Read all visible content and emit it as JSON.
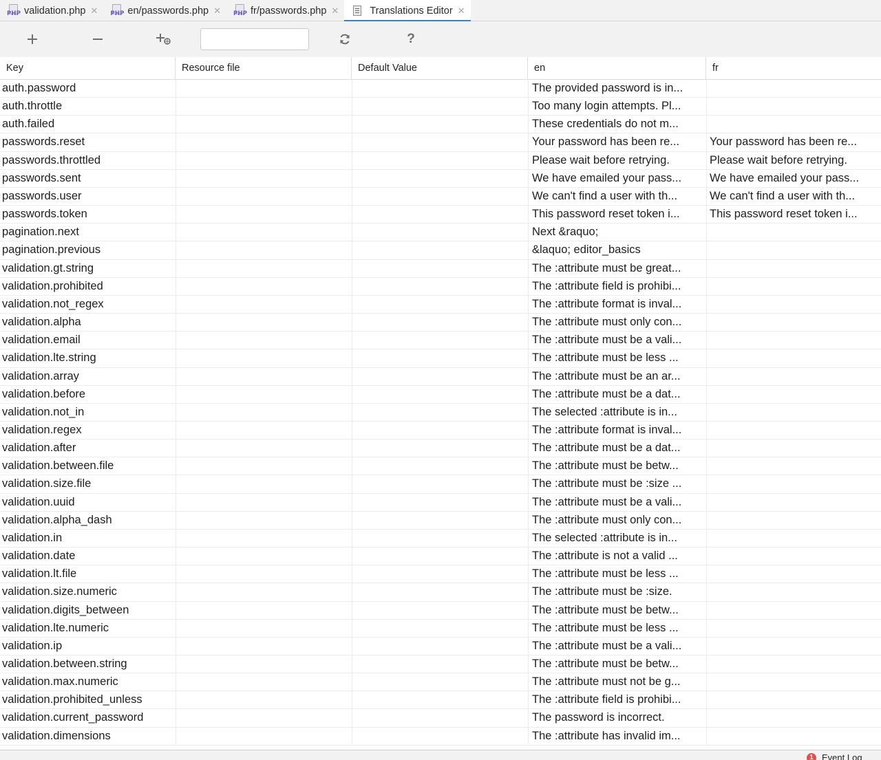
{
  "tabs": [
    {
      "label": "validation.php",
      "icon": "php-file-icon",
      "badge": "PHP"
    },
    {
      "label": "en/passwords.php",
      "icon": "php-file-icon",
      "badge": "PHP"
    },
    {
      "label": "fr/passwords.php",
      "icon": "php-file-icon",
      "badge": "PHP"
    },
    {
      "label": "Translations Editor",
      "icon": "document-icon",
      "active": true
    }
  ],
  "toolbar": {
    "add_icon": "plus-icon",
    "remove_icon": "minus-icon",
    "add_locale_icon": "add-locale-icon",
    "search_value": "",
    "refresh_icon": "refresh-icon",
    "help_label": "?"
  },
  "table": {
    "columns": [
      "Key",
      "Resource file",
      "Default Value",
      "en",
      "fr"
    ],
    "rows": [
      {
        "key": "auth.password",
        "resource": "",
        "default": "",
        "en": "The provided password is in...",
        "fr": ""
      },
      {
        "key": "auth.throttle",
        "resource": "",
        "default": "",
        "en": "Too many login attempts. Pl...",
        "fr": ""
      },
      {
        "key": "auth.failed",
        "resource": "",
        "default": "",
        "en": "These credentials do not m...",
        "fr": ""
      },
      {
        "key": "passwords.reset",
        "resource": "",
        "default": "",
        "en": "Your password has been re...",
        "fr": "Your password has been re..."
      },
      {
        "key": "passwords.throttled",
        "resource": "",
        "default": "",
        "en": "Please wait before retrying.",
        "fr": "Please wait before retrying."
      },
      {
        "key": "passwords.sent",
        "resource": "",
        "default": "",
        "en": "We have emailed your pass...",
        "fr": "We have emailed your pass..."
      },
      {
        "key": "passwords.user",
        "resource": "",
        "default": "",
        "en": "We can't find a user with th...",
        "fr": "We can't find a user with th..."
      },
      {
        "key": "passwords.token",
        "resource": "",
        "default": "",
        "en": "This password reset token i...",
        "fr": "This password reset token i..."
      },
      {
        "key": "pagination.next",
        "resource": "",
        "default": "",
        "en": "Next &raquo;",
        "fr": ""
      },
      {
        "key": "pagination.previous",
        "resource": "",
        "default": "",
        "en": "&laquo; editor_basics",
        "fr": ""
      },
      {
        "key": "validation.gt.string",
        "resource": "",
        "default": "",
        "en": "The :attribute must be great...",
        "fr": ""
      },
      {
        "key": "validation.prohibited",
        "resource": "",
        "default": "",
        "en": "The :attribute field is prohibi...",
        "fr": ""
      },
      {
        "key": "validation.not_regex",
        "resource": "",
        "default": "",
        "en": "The :attribute format is inval...",
        "fr": ""
      },
      {
        "key": "validation.alpha",
        "resource": "",
        "default": "",
        "en": "The :attribute must only con...",
        "fr": ""
      },
      {
        "key": "validation.email",
        "resource": "",
        "default": "",
        "en": "The :attribute must be a vali...",
        "fr": ""
      },
      {
        "key": "validation.lte.string",
        "resource": "",
        "default": "",
        "en": "The :attribute must be less ...",
        "fr": ""
      },
      {
        "key": "validation.array",
        "resource": "",
        "default": "",
        "en": "The :attribute must be an ar...",
        "fr": ""
      },
      {
        "key": "validation.before",
        "resource": "",
        "default": "",
        "en": "The :attribute must be a dat...",
        "fr": ""
      },
      {
        "key": "validation.not_in",
        "resource": "",
        "default": "",
        "en": "The selected :attribute is in...",
        "fr": ""
      },
      {
        "key": "validation.regex",
        "resource": "",
        "default": "",
        "en": "The :attribute format is inval...",
        "fr": ""
      },
      {
        "key": "validation.after",
        "resource": "",
        "default": "",
        "en": "The :attribute must be a dat...",
        "fr": ""
      },
      {
        "key": "validation.between.file",
        "resource": "",
        "default": "",
        "en": "The :attribute must be betw...",
        "fr": ""
      },
      {
        "key": "validation.size.file",
        "resource": "",
        "default": "",
        "en": "The :attribute must be :size ...",
        "fr": ""
      },
      {
        "key": "validation.uuid",
        "resource": "",
        "default": "",
        "en": "The :attribute must be a vali...",
        "fr": ""
      },
      {
        "key": "validation.alpha_dash",
        "resource": "",
        "default": "",
        "en": "The :attribute must only con...",
        "fr": ""
      },
      {
        "key": "validation.in",
        "resource": "",
        "default": "",
        "en": "The selected :attribute is in...",
        "fr": ""
      },
      {
        "key": "validation.date",
        "resource": "",
        "default": "",
        "en": "The :attribute is not a valid ...",
        "fr": ""
      },
      {
        "key": "validation.lt.file",
        "resource": "",
        "default": "",
        "en": "The :attribute must be less ...",
        "fr": ""
      },
      {
        "key": "validation.size.numeric",
        "resource": "",
        "default": "",
        "en": "The :attribute must be :size.",
        "fr": ""
      },
      {
        "key": "validation.digits_between",
        "resource": "",
        "default": "",
        "en": "The :attribute must be betw...",
        "fr": ""
      },
      {
        "key": "validation.lte.numeric",
        "resource": "",
        "default": "",
        "en": "The :attribute must be less ...",
        "fr": ""
      },
      {
        "key": "validation.ip",
        "resource": "",
        "default": "",
        "en": "The :attribute must be a vali...",
        "fr": ""
      },
      {
        "key": "validation.between.string",
        "resource": "",
        "default": "",
        "en": "The :attribute must be betw...",
        "fr": ""
      },
      {
        "key": "validation.max.numeric",
        "resource": "",
        "default": "",
        "en": "The :attribute must not be g...",
        "fr": ""
      },
      {
        "key": "validation.prohibited_unless",
        "resource": "",
        "default": "",
        "en": "The :attribute field is prohibi...",
        "fr": ""
      },
      {
        "key": "validation.current_password",
        "resource": "",
        "default": "",
        "en": "The password is incorrect.",
        "fr": ""
      },
      {
        "key": "validation.dimensions",
        "resource": "",
        "default": "",
        "en": "The :attribute has invalid im...",
        "fr": ""
      }
    ]
  },
  "statusbar": {
    "event_log_label": "Event Log",
    "event_log_count": "1",
    "event_log_color": "#d9534f"
  },
  "colors": {
    "accent": "#3d7fcf",
    "php_badge": "#6b5bb5"
  }
}
